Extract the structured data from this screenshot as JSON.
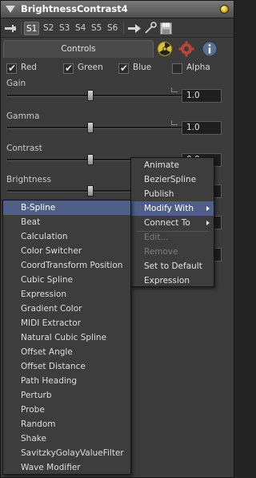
{
  "window": {
    "title": "BrightnessContrast4"
  },
  "toolbar": {
    "slots": [
      "S1",
      "S2",
      "S3",
      "S4",
      "S5",
      "S6"
    ],
    "active_slot": "S1"
  },
  "tabs": {
    "controls_label": "Controls"
  },
  "channels": [
    {
      "label": "Red",
      "checked": true
    },
    {
      "label": "Green",
      "checked": true
    },
    {
      "label": "Blue",
      "checked": true
    },
    {
      "label": "Alpha",
      "checked": false
    }
  ],
  "params": {
    "gain": {
      "label": "Gain",
      "value": "1.0"
    },
    "gamma": {
      "label": "Gamma",
      "value": "1.0"
    },
    "contrast": {
      "label": "Contrast",
      "value": "0.0"
    },
    "brightness": {
      "label": "Brightness"
    }
  },
  "context_menu": {
    "items": [
      {
        "label": "Animate",
        "enabled": true,
        "submenu": false
      },
      {
        "label": "BezierSpline",
        "enabled": true,
        "submenu": false
      },
      {
        "label": "Publish",
        "enabled": true,
        "submenu": false
      },
      {
        "label": "Modify With",
        "enabled": true,
        "submenu": true,
        "highlighted": true
      },
      {
        "label": "Connect To",
        "enabled": true,
        "submenu": true
      },
      {
        "label": "Edit...",
        "enabled": false,
        "submenu": false
      },
      {
        "label": "Remove",
        "enabled": false,
        "submenu": false
      },
      {
        "label": "Set to Default",
        "enabled": true,
        "submenu": false
      },
      {
        "label": "Expression",
        "enabled": true,
        "submenu": false
      }
    ]
  },
  "modify_with_submenu": {
    "items": [
      "B-Spline",
      "Beat",
      "Calculation",
      "Color Switcher",
      "CoordTransform Position",
      "Cubic Spline",
      "Expression",
      "Gradient Color",
      "MIDI Extractor",
      "Natural Cubic Spline",
      "Offset Angle",
      "Offset Distance",
      "Path Heading",
      "Perturb",
      "Probe",
      "Random",
      "Shake",
      "SavitzkyGolayValueFilter",
      "Wave Modifier"
    ],
    "highlighted": "B-Spline"
  },
  "colors": {
    "highlight": "#4f5f87",
    "panel": "#3c3c3c",
    "title_gradient_top": "#7a7a7a"
  }
}
